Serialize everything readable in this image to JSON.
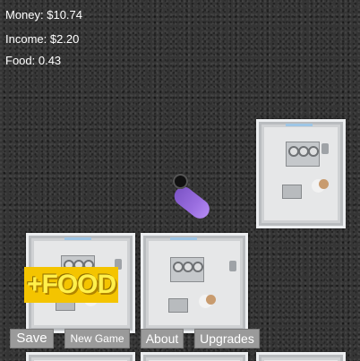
{
  "stats": {
    "money": "Money: $10.74",
    "income": "Income: $2.20",
    "food": "Food: 0.43"
  },
  "food_button": "+FOOD",
  "buttons": {
    "save": "Save",
    "new_game": "New Game",
    "about": "About",
    "upgrades": "Upgrades"
  },
  "colors": {
    "background": "#353535",
    "food_button": "#f4c400",
    "creature": "#9a6ee0",
    "ui_button": "#9a9a9a"
  }
}
